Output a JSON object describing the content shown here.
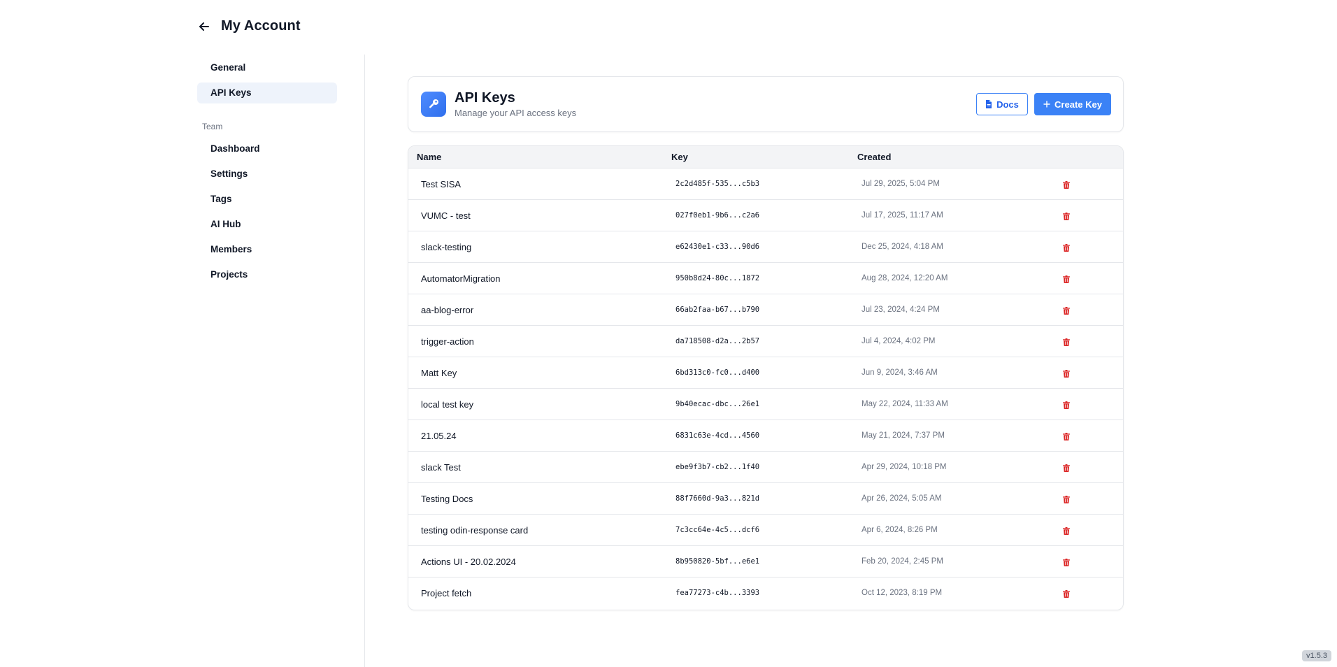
{
  "header": {
    "title": "My Account"
  },
  "sidebar": {
    "items": [
      {
        "label": "General",
        "active": false
      },
      {
        "label": "API Keys",
        "active": true
      }
    ],
    "team_section": "Team",
    "team_items": [
      {
        "label": "Dashboard"
      },
      {
        "label": "Settings"
      },
      {
        "label": "Tags"
      },
      {
        "label": "AI Hub"
      },
      {
        "label": "Members"
      },
      {
        "label": "Projects"
      }
    ]
  },
  "card": {
    "title": "API Keys",
    "subtitle": "Manage your API access keys",
    "docs_label": "Docs",
    "create_label": "Create Key"
  },
  "table": {
    "columns": {
      "name": "Name",
      "key": "Key",
      "created": "Created"
    },
    "rows": [
      {
        "name": "Test SISA",
        "key": "2c2d485f-535...c5b3",
        "created": "Jul 29, 2025, 5:04 PM"
      },
      {
        "name": "VUMC - test",
        "key": "027f0eb1-9b6...c2a6",
        "created": "Jul 17, 2025, 11:17 AM"
      },
      {
        "name": "slack-testing",
        "key": "e62430e1-c33...90d6",
        "created": "Dec 25, 2024, 4:18 AM"
      },
      {
        "name": "AutomatorMigration",
        "key": "950b8d24-80c...1872",
        "created": "Aug 28, 2024, 12:20 AM"
      },
      {
        "name": "aa-blog-error",
        "key": "66ab2faa-b67...b790",
        "created": "Jul 23, 2024, 4:24 PM"
      },
      {
        "name": "trigger-action",
        "key": "da718508-d2a...2b57",
        "created": "Jul 4, 2024, 4:02 PM"
      },
      {
        "name": "Matt Key",
        "key": "6bd313c0-fc0...d400",
        "created": "Jun 9, 2024, 3:46 AM"
      },
      {
        "name": "local test key",
        "key": "9b40ecac-dbc...26e1",
        "created": "May 22, 2024, 11:33 AM"
      },
      {
        "name": "21.05.24",
        "key": "6831c63e-4cd...4560",
        "created": "May 21, 2024, 7:37 PM"
      },
      {
        "name": "slack Test",
        "key": "ebe9f3b7-cb2...1f40",
        "created": "Apr 29, 2024, 10:18 PM"
      },
      {
        "name": "Testing Docs",
        "key": "88f7660d-9a3...821d",
        "created": "Apr 26, 2024, 5:05 AM"
      },
      {
        "name": "testing odin-response card",
        "key": "7c3cc64e-4c5...dcf6",
        "created": "Apr 6, 2024, 8:26 PM"
      },
      {
        "name": "Actions UI - 20.02.2024",
        "key": "8b950820-5bf...e6e1",
        "created": "Feb 20, 2024, 2:45 PM"
      },
      {
        "name": "Project fetch",
        "key": "fea77273-c4b...3393",
        "created": "Oct 12, 2023, 8:19 PM"
      }
    ]
  },
  "version": "v1.5.3",
  "colors": {
    "accent": "#3b82f6",
    "delete": "#dc2626",
    "active_nav": "#eef3fb"
  },
  "icons": {
    "back": "arrow-left-icon",
    "key": "key-icon",
    "docs": "document-icon",
    "add": "plus-icon",
    "delete": "trash-icon"
  }
}
